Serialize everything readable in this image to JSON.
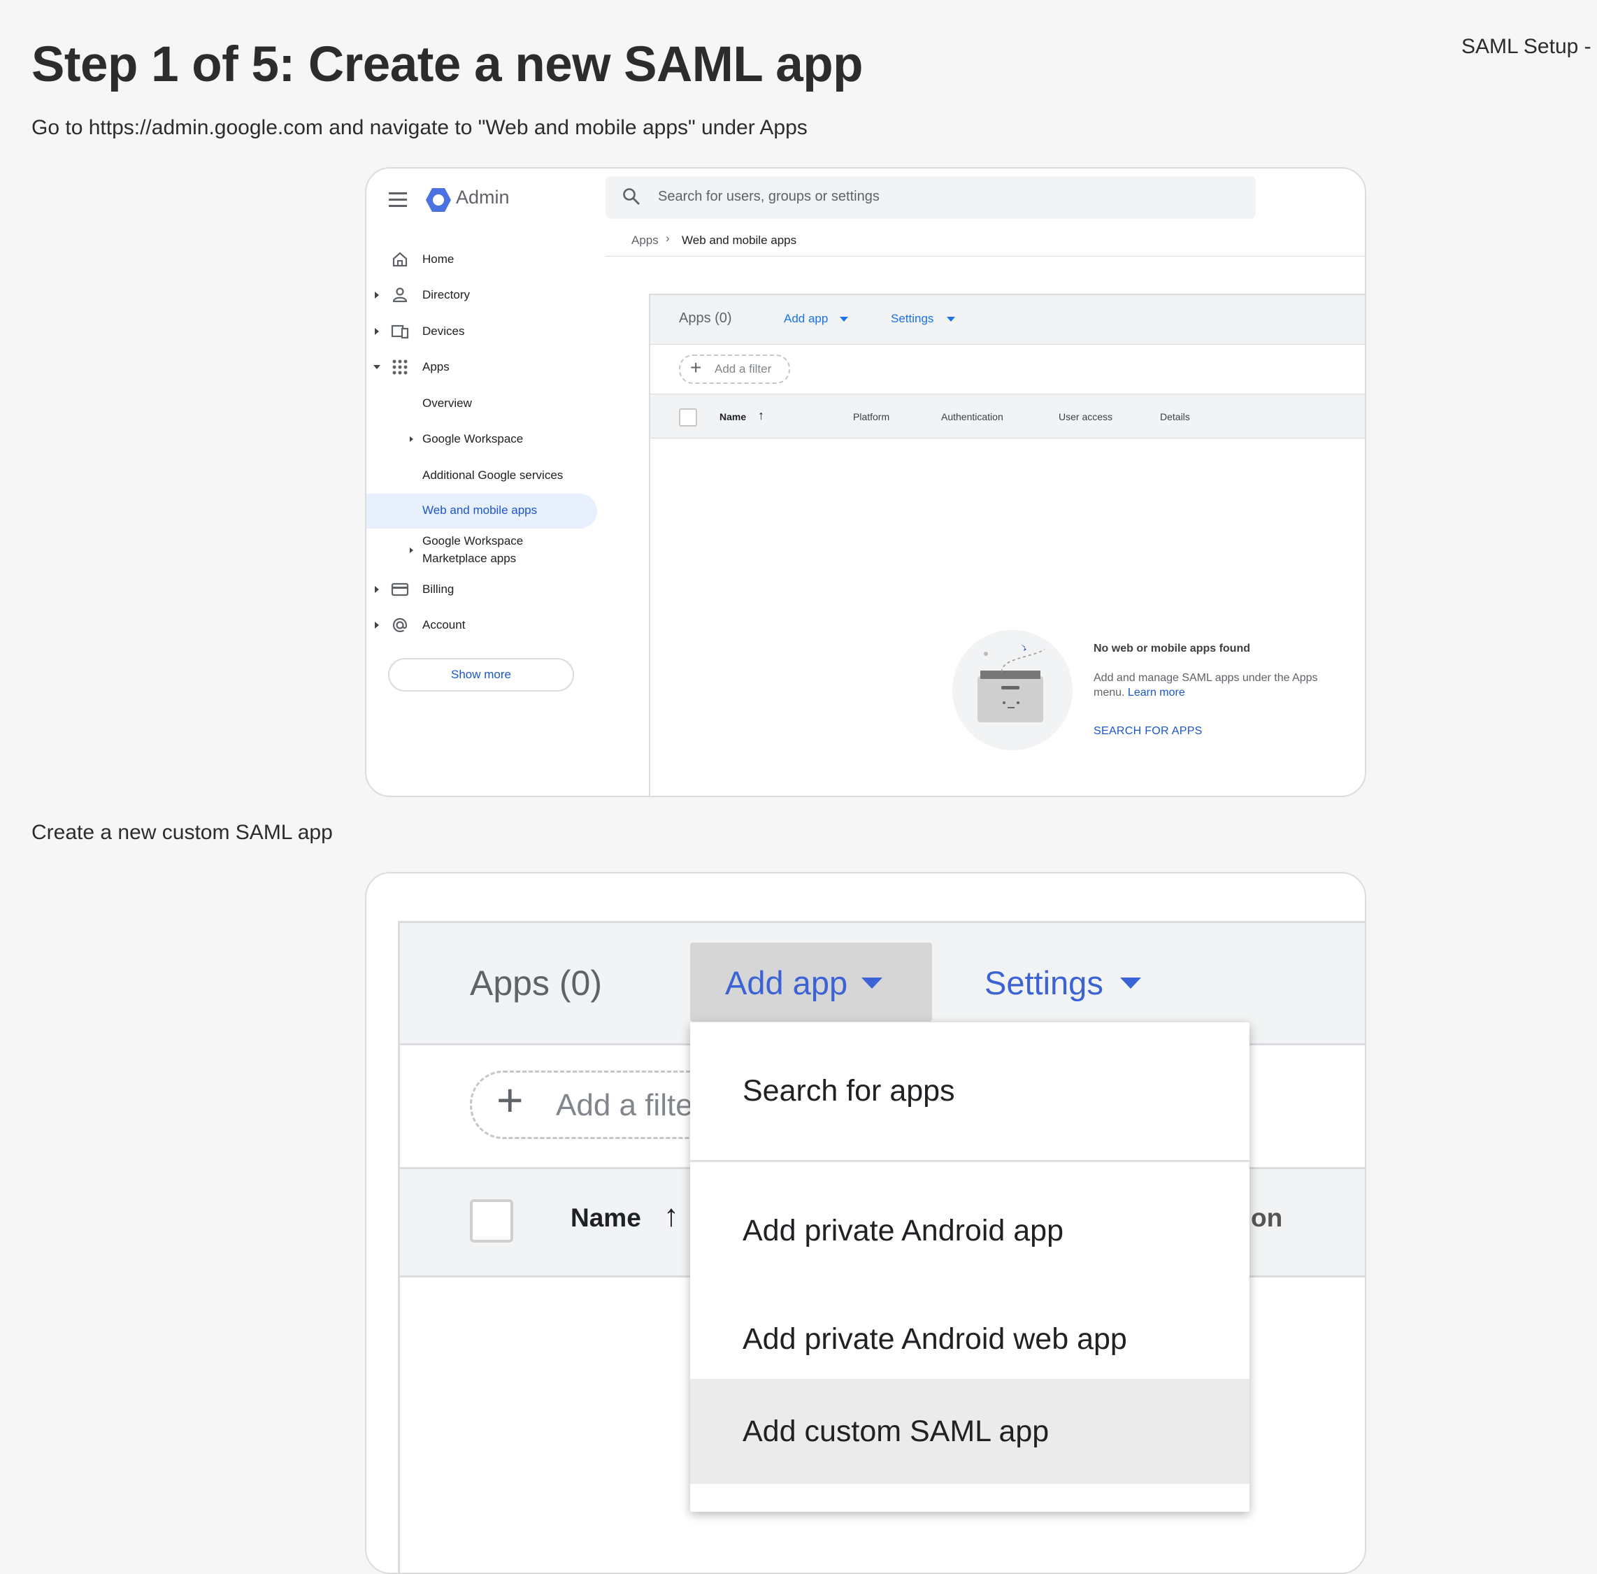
{
  "page": {
    "title": "Step 1 of 5: Create a new SAML app",
    "header_right": "SAML Setup -",
    "instruction_1": "Go to https://admin.google.com and navigate to \"Web and mobile apps\" under Apps",
    "instruction_2": "Create a new custom SAML app"
  },
  "admin": {
    "brand": "Admin",
    "search_placeholder": "Search for users, groups or settings",
    "breadcrumb": {
      "root": "Apps",
      "current": "Web and mobile apps"
    },
    "nav": {
      "home": "Home",
      "directory": "Directory",
      "devices": "Devices",
      "apps": "Apps",
      "overview": "Overview",
      "google_workspace": "Google Workspace",
      "additional_services": "Additional Google services",
      "web_mobile_apps": "Web and mobile apps",
      "marketplace_line1": "Google Workspace",
      "marketplace_line2": "Marketplace apps",
      "billing": "Billing",
      "account": "Account",
      "show_more": "Show more"
    },
    "toolbar": {
      "apps_count": "Apps (0)",
      "add_app": "Add app",
      "settings": "Settings"
    },
    "filter": "Add a filter",
    "columns": [
      "Name",
      "Platform",
      "Authentication",
      "User access",
      "Details"
    ],
    "empty": {
      "title": "No web or mobile apps found",
      "desc_line1": "Add and manage SAML apps under the Apps",
      "desc_line2": "menu.",
      "learn_more": "Learn more",
      "action": "SEARCH FOR APPS"
    },
    "colors": {
      "accent": "#1a73e8",
      "selected_bg": "#e8f0fe",
      "selected_text": "#1a56c8"
    }
  },
  "zoomed": {
    "apps_count": "Apps (0)",
    "add_app": "Add app",
    "settings": "Settings",
    "filter_partial": "Add a filte",
    "name_col": "Name",
    "partial_col": "on",
    "menu": [
      "Search for apps",
      "Add private Android app",
      "Add private Android web app",
      "Add custom SAML app"
    ],
    "highlighted_item": "Add custom SAML app"
  }
}
